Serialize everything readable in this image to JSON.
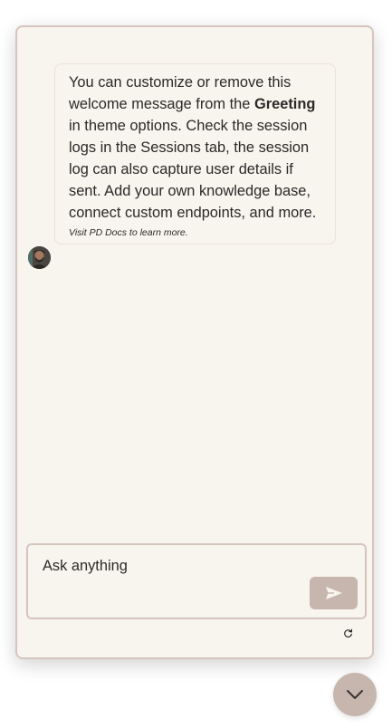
{
  "colors": {
    "panel_background": "#f8f4ee",
    "panel_border": "#d6c5bd",
    "accent": "#c6b6ae",
    "text": "#2b2a28"
  },
  "message": {
    "text_before_bold": "You can customize or remove this welcome message from the ",
    "bold_text": "Greeting",
    "text_after_bold": " in theme options. Check the session logs in the Sessions tab, the session log can also capture user details if sent. Add your own knowledge base, connect custom endpoints, and more.",
    "footer": "Visit PD Docs to learn more.",
    "avatar_icon": "user-avatar-photo"
  },
  "composer": {
    "placeholder": "Ask anything",
    "value": "",
    "send_icon": "send-arrow-icon"
  },
  "controls": {
    "refresh_icon": "refresh-icon",
    "collapse_icon": "chevron-down-icon"
  }
}
